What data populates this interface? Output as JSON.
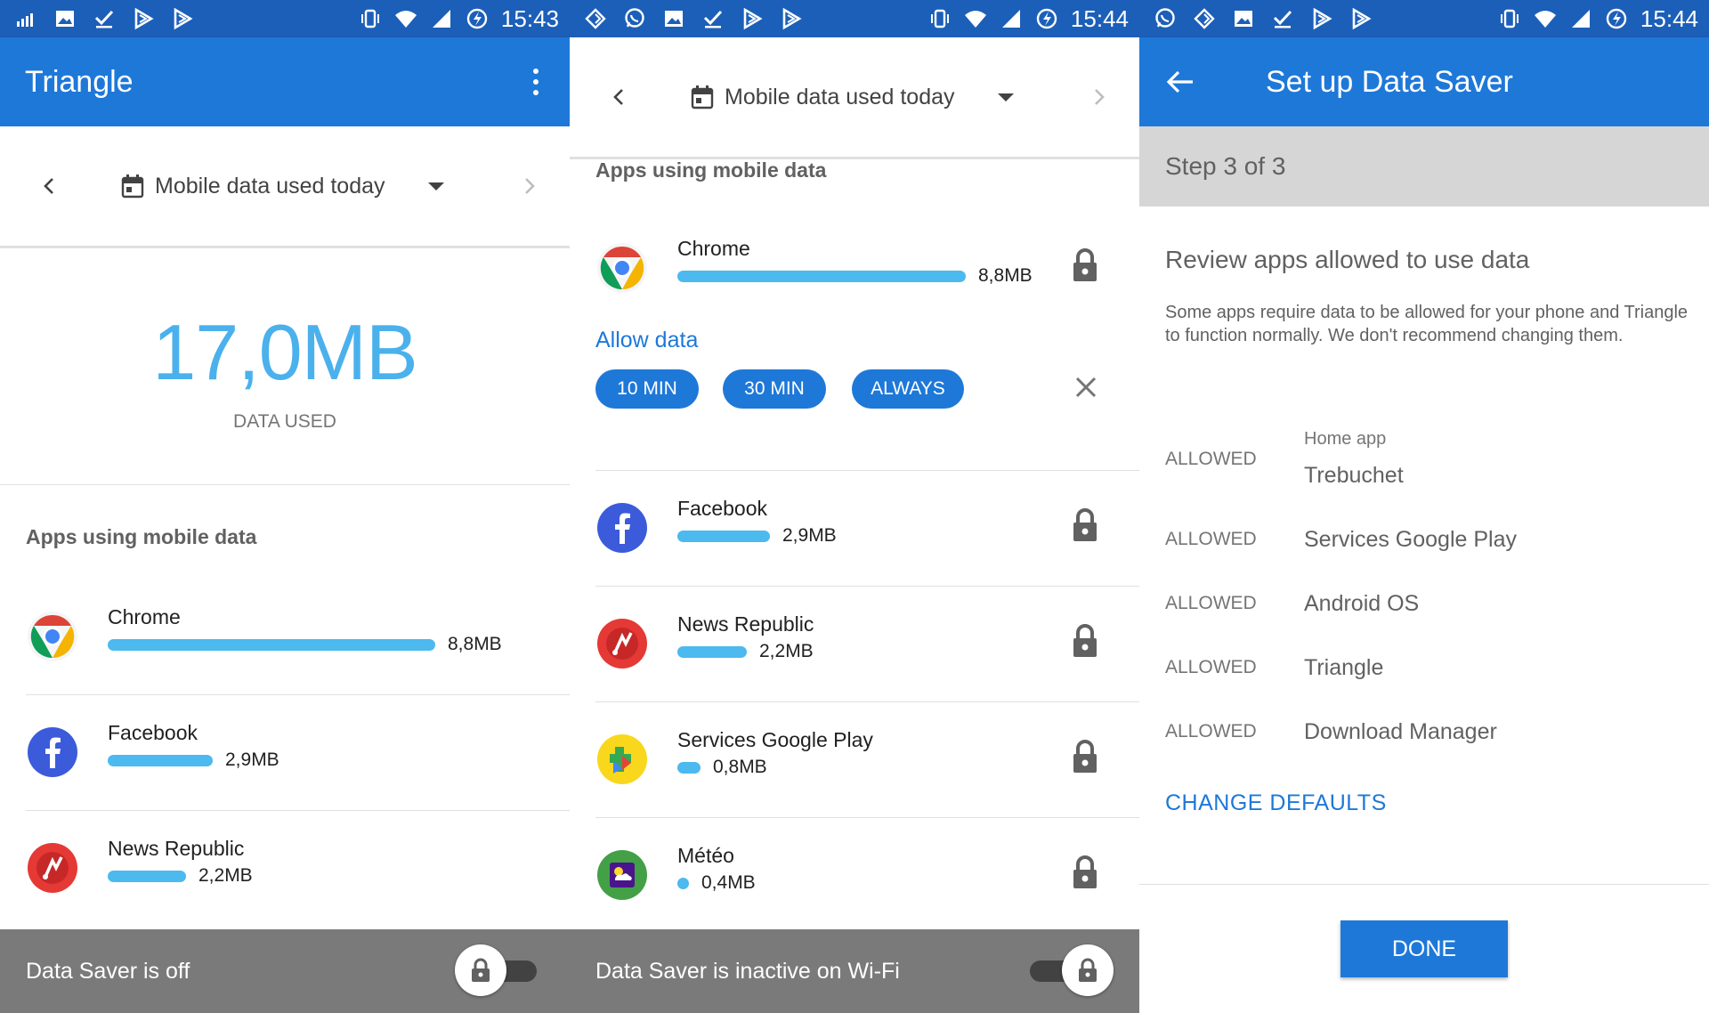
{
  "colors": {
    "status_bar": "#1c5fb8",
    "app_bar": "#1e78d8",
    "accent": "#1e78d8",
    "usage_bar": "#4cb9ef",
    "big_number": "#4ab1ec",
    "footer": "#7a7a7a",
    "step_band": "#d6d6d6"
  },
  "screen1": {
    "status": {
      "time": "15:43",
      "left_icons": [
        "signal-bars-icon",
        "image-icon",
        "check-icon",
        "play-store-icon",
        "play-store-icon"
      ],
      "right_icons": [
        "vibrate-icon",
        "wifi-icon",
        "cell-signal-icon",
        "battery-saver-icon"
      ]
    },
    "app_title": "Triangle",
    "period": {
      "label": "Mobile data used today"
    },
    "total": {
      "value": "17,0MB",
      "caption": "DATA USED"
    },
    "section_title": "Apps using mobile data",
    "apps": [
      {
        "name": "Chrome",
        "usage": "8,8MB",
        "fraction": 1.0,
        "icon": "chrome-icon"
      },
      {
        "name": "Facebook",
        "usage": "2,9MB",
        "fraction": 0.32,
        "icon": "facebook-icon"
      },
      {
        "name": "News Republic",
        "usage": "2,2MB",
        "fraction": 0.24,
        "icon": "news-republic-icon"
      }
    ],
    "footer": {
      "text": "Data Saver is off",
      "toggle_on": false
    }
  },
  "screen2": {
    "status": {
      "time": "15:44",
      "left_icons": [
        "sync-icon",
        "whatsapp-icon",
        "image-icon",
        "check-icon",
        "play-store-icon",
        "play-store-icon"
      ],
      "right_icons": [
        "vibrate-icon",
        "wifi-icon",
        "cell-signal-icon",
        "battery-saver-icon"
      ]
    },
    "period": {
      "label": "Mobile data used today"
    },
    "section_title": "Apps using mobile data",
    "apps": [
      {
        "name": "Chrome",
        "usage": "8,8MB",
        "fraction": 1.0,
        "icon": "chrome-icon"
      },
      {
        "name": "Facebook",
        "usage": "2,9MB",
        "fraction": 0.32,
        "icon": "facebook-icon"
      },
      {
        "name": "News Republic",
        "usage": "2,2MB",
        "fraction": 0.24,
        "icon": "news-republic-icon"
      },
      {
        "name": "Services Google Play",
        "usage": "0,8MB",
        "fraction": 0.08,
        "icon": "google-play-services-icon"
      },
      {
        "name": "Météo",
        "usage": "0,4MB",
        "fraction": 0.04,
        "icon": "meteo-icon"
      }
    ],
    "allow": {
      "label": "Allow data",
      "options": [
        "10 MIN",
        "30 MIN",
        "ALWAYS"
      ]
    },
    "footer": {
      "text": "Data Saver is inactive on Wi-Fi",
      "toggle_on": true
    }
  },
  "screen3": {
    "status": {
      "time": "15:44",
      "left_icons": [
        "whatsapp-icon",
        "sync-icon",
        "image-icon",
        "check-icon",
        "play-store-icon",
        "play-store-icon"
      ],
      "right_icons": [
        "vibrate-icon",
        "wifi-icon",
        "cell-signal-icon",
        "battery-saver-icon"
      ]
    },
    "app_title": "Set up Data Saver",
    "step": "Step 3 of 3",
    "review_title": "Review apps allowed to use data",
    "review_desc": "Some apps require data to be allowed for your phone and Triangle to function normally. We don't recommend changing them.",
    "allowed": [
      {
        "tag": "ALLOWED",
        "sub": "Home app",
        "name": "Trebuchet"
      },
      {
        "tag": "ALLOWED",
        "name": "Services Google Play"
      },
      {
        "tag": "ALLOWED",
        "name": "Android OS"
      },
      {
        "tag": "ALLOWED",
        "name": "Triangle"
      },
      {
        "tag": "ALLOWED",
        "name": "Download Manager"
      }
    ],
    "change_defaults": "CHANGE DEFAULTS",
    "done": "DONE"
  }
}
